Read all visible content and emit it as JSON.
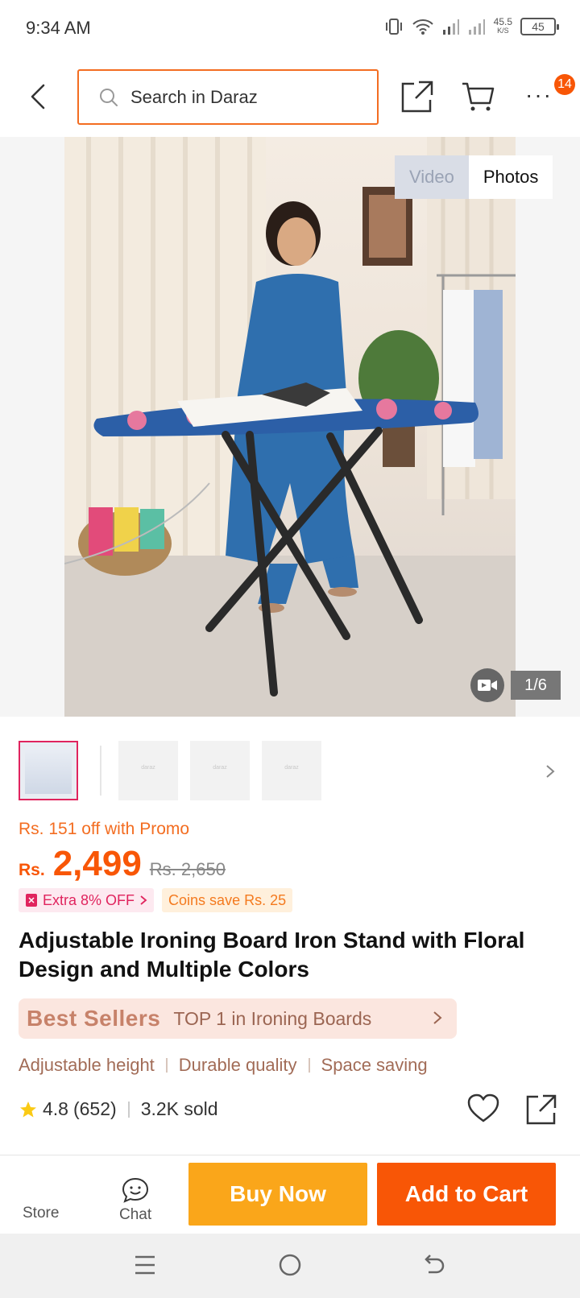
{
  "status_bar": {
    "time": "9:34 AM",
    "net_speed": "45.5",
    "net_speed_unit": "K/S",
    "battery": "45"
  },
  "header": {
    "search_placeholder": "Search in Daraz",
    "notification_count": "14"
  },
  "gallery": {
    "toggle_video": "Video",
    "toggle_photos": "Photos",
    "counter": "1/6",
    "thumb_placeholder": "daraz"
  },
  "price": {
    "promo": "Rs. 151 off with Promo",
    "currency": "Rs.",
    "amount": "2,499",
    "original": "Rs. 2,650"
  },
  "tags": {
    "extra": "Extra 8% OFF",
    "coins": "Coins save Rs. 25"
  },
  "product": {
    "title": "Adjustable Ironing Board Iron Stand with Floral Design and Multiple Colors"
  },
  "best_sellers": {
    "label": "Best Sellers",
    "rank": "TOP 1 in Ironing Boards"
  },
  "features": [
    "Adjustable height",
    "Durable quality",
    "Space saving"
  ],
  "rating": {
    "score": "4.8",
    "count": "(652)",
    "sold": "3.2K sold"
  },
  "bottom_bar": {
    "store": "Store",
    "chat": "Chat",
    "buy_now": "Buy Now",
    "add_to_cart": "Add to Cart"
  },
  "colors": {
    "brand_orange": "#f85606",
    "buy_now": "#faa61a",
    "promo_pink": "#e0245e"
  }
}
